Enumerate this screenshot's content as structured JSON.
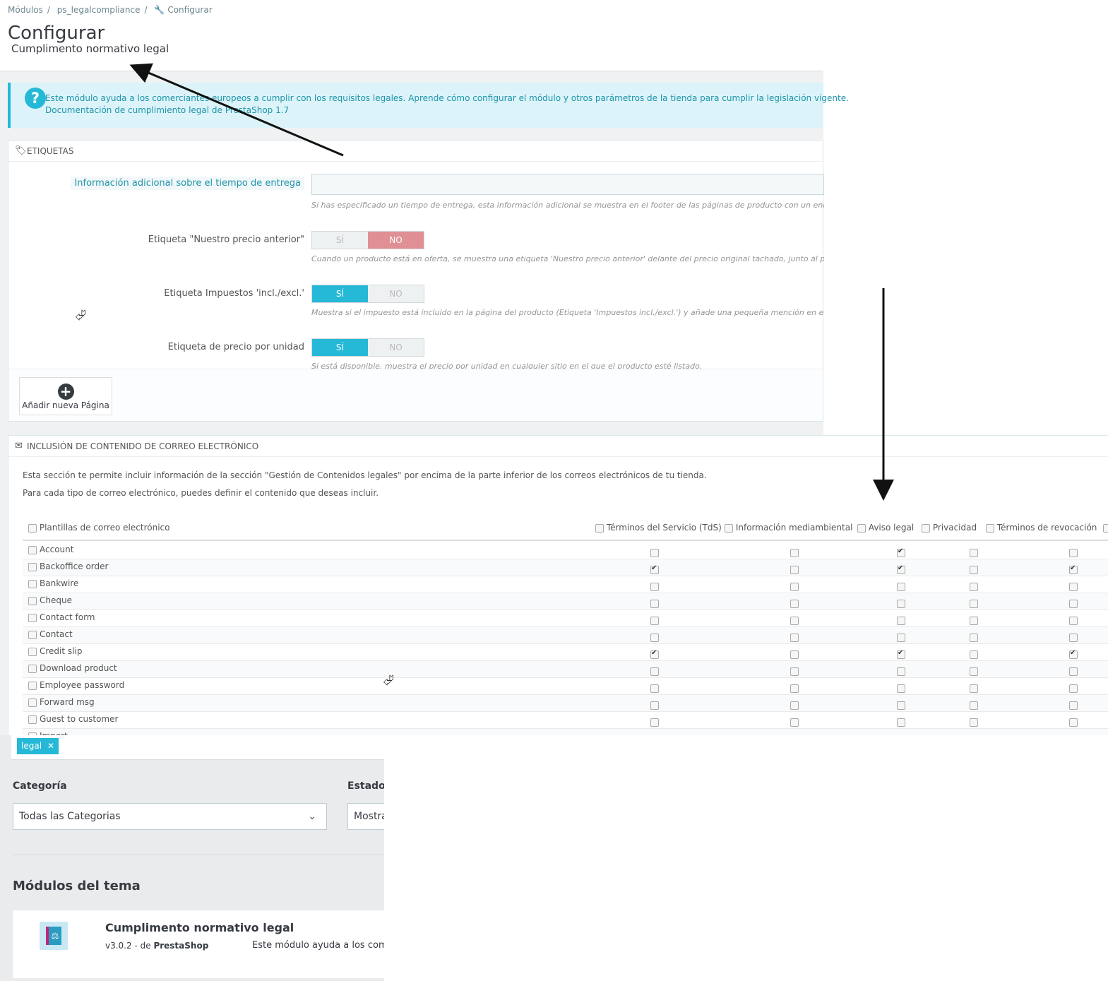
{
  "breadcrumb": {
    "items": [
      "Módulos",
      "ps_legalcompliance",
      "Configurar"
    ],
    "separator": "/"
  },
  "header": {
    "title": "Configurar",
    "subtitle": "Cumplimento normativo legal"
  },
  "info_alert": {
    "text": "Este módulo ayuda a los comerciantes europeos a cumplir con los requisitos legales. Aprende cómo configurar el módulo y otros parámetros de la tienda para cumplir la legislación vigente.",
    "link": "Documentación de cumplimiento legal de PrestaShop 1.7"
  },
  "labels_panel": {
    "title": "ETIQUETAS",
    "fields": [
      {
        "label": "Información adicional sobre el tiempo de entrega",
        "value": "",
        "help": "Si has especificado un tiempo de entrega, esta información adicional se muestra en el footer de las páginas de producto con un enlace a l"
      },
      {
        "label": "Etiqueta \"Nuestro precio anterior\"",
        "value": "NO",
        "yes": "SÍ",
        "no": "NO",
        "help": "Cuando un producto está en oferta, se muestra una etiqueta 'Nuestro precio anterior' delante del precio original tachado, junto al precio c"
      },
      {
        "label": "Etiqueta Impuestos 'incl./excl.'",
        "value": "SÍ",
        "yes": "SÍ",
        "no": "NO",
        "help": "Muestra si el impuesto está incluido en la página del producto (Etiqueta 'Impuestos incl./excl.') y añade una pequeña mención en el footer"
      },
      {
        "label": "Etiqueta de precio por unidad",
        "value": "SÍ",
        "yes": "SÍ",
        "no": "NO",
        "help": "Si está disponible, muestra el precio por unidad en cualquier sitio en el que el producto esté listado."
      }
    ],
    "add_page_label": "Añadir nueva Página"
  },
  "email_panel": {
    "title": "INCLUSIÓN DE CONTENIDO DE CORREO ELECTRÓNICO",
    "desc1": "Esta sección te permite incluir información de la sección \"Gestión de Contenidos legales\" por encima de la parte inferior de los correos electrónicos de tu tienda.",
    "desc2": "Para cada tipo de correo electrónico, puedes definir el contenido que deseas incluir.",
    "first_column": "Plantillas de correo electrónico",
    "columns": [
      "Términos del Servicio (TdS)",
      "Información mediambiental",
      "Aviso legal",
      "Privacidad",
      "Términos de revocación"
    ],
    "rows": [
      {
        "name": "Account",
        "checks": [
          false,
          false,
          true,
          false,
          false
        ]
      },
      {
        "name": "Backoffice order",
        "checks": [
          true,
          false,
          true,
          false,
          true
        ]
      },
      {
        "name": "Bankwire",
        "checks": [
          false,
          false,
          false,
          false,
          false
        ]
      },
      {
        "name": "Cheque",
        "checks": [
          false,
          false,
          false,
          false,
          false
        ]
      },
      {
        "name": "Contact form",
        "checks": [
          false,
          false,
          false,
          false,
          false
        ]
      },
      {
        "name": "Contact",
        "checks": [
          false,
          false,
          false,
          false,
          false
        ]
      },
      {
        "name": "Credit slip",
        "checks": [
          true,
          false,
          true,
          false,
          true
        ]
      },
      {
        "name": "Download product",
        "checks": [
          false,
          false,
          false,
          false,
          false
        ]
      },
      {
        "name": "Employee password",
        "checks": [
          false,
          false,
          false,
          false,
          false
        ]
      },
      {
        "name": "Forward msg",
        "checks": [
          false,
          false,
          false,
          false,
          false
        ]
      },
      {
        "name": "Guest to customer",
        "checks": [
          false,
          false,
          false,
          false,
          false
        ]
      },
      {
        "name": "Import",
        "checks": [
          false,
          false,
          false,
          false,
          false
        ]
      }
    ]
  },
  "module_search": {
    "tag": "legal",
    "category_label": "Categoría",
    "category_value": "Todas las Categorias",
    "status_label": "Estado",
    "status_value": "Mostrar todos",
    "section_title": "Módulos del tema",
    "module": {
      "name": "Cumplimento normativo legal",
      "version": "v3.0.2",
      "by": "de",
      "author": "PrestaShop",
      "description": "Este módulo ayuda a los comerciantes europeos"
    }
  },
  "colors": {
    "accent": "#25b9d7",
    "no_active": "#e08f95",
    "text": "#363a41",
    "arrow": "#111111"
  }
}
